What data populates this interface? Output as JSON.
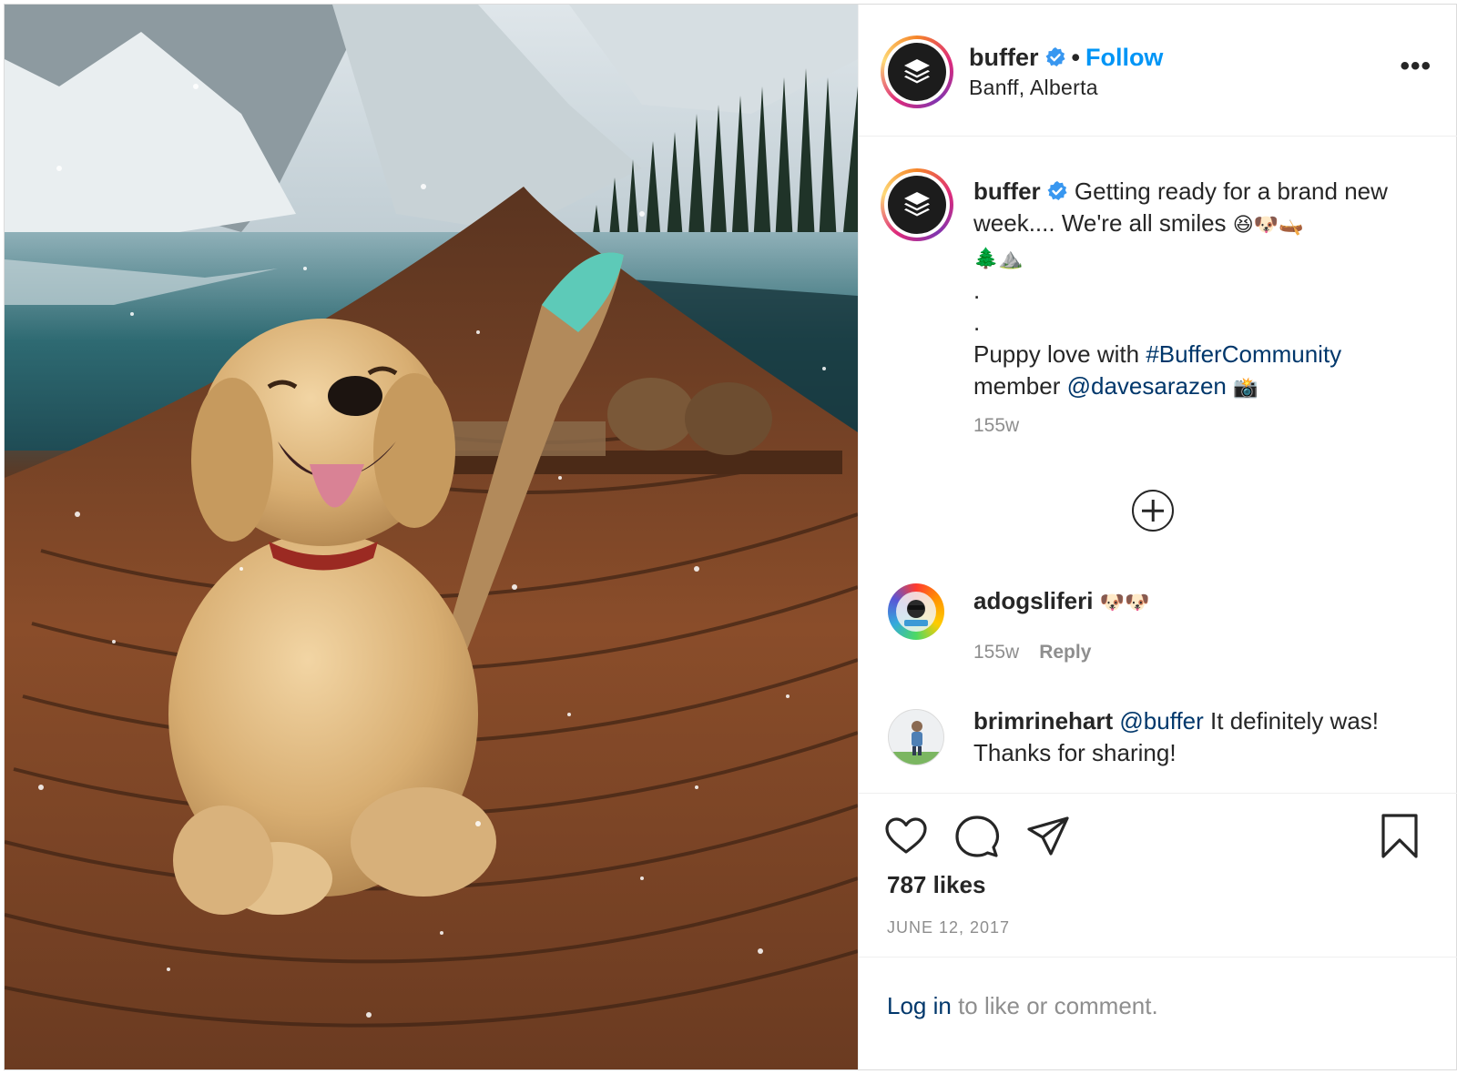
{
  "post": {
    "image_alt": "golden retriever puppy sitting in a wooden canoe on a mountain lake with snow falling",
    "header": {
      "username": "buffer",
      "separator": "•",
      "follow_label": "Follow",
      "location": "Banff, Alberta",
      "more_icon": "more-options-icon",
      "more_label": "•••"
    },
    "caption": {
      "username": "buffer",
      "line1": "Getting ready for a brand new week.... We're all smiles",
      "emojis1": "😆🐶🛶",
      "emojis2": "🌲⛰️",
      "dot1": ".",
      "dot2": ".",
      "line2_prefix": "Puppy love with",
      "hashtag": "#BufferCommunity",
      "line2_middle": "member",
      "mention": "@davesarazen",
      "emoji_camera": "📸",
      "time": "155w"
    },
    "comments": [
      {
        "username": "adogsliferi",
        "text": "🐶🐶",
        "time": "155w",
        "reply_label": "Reply"
      },
      {
        "username": "brimrinehart",
        "mention": "@buffer",
        "text": "It definitely was! Thanks for sharing!"
      }
    ],
    "likes": "787 likes",
    "date": "JUNE 12, 2017",
    "login": {
      "link": "Log in",
      "rest": "to like or comment."
    },
    "colors": {
      "follow": "#0095f6",
      "link": "#00376b",
      "muted": "#8e8e8e",
      "verified": "#3897f0"
    }
  }
}
